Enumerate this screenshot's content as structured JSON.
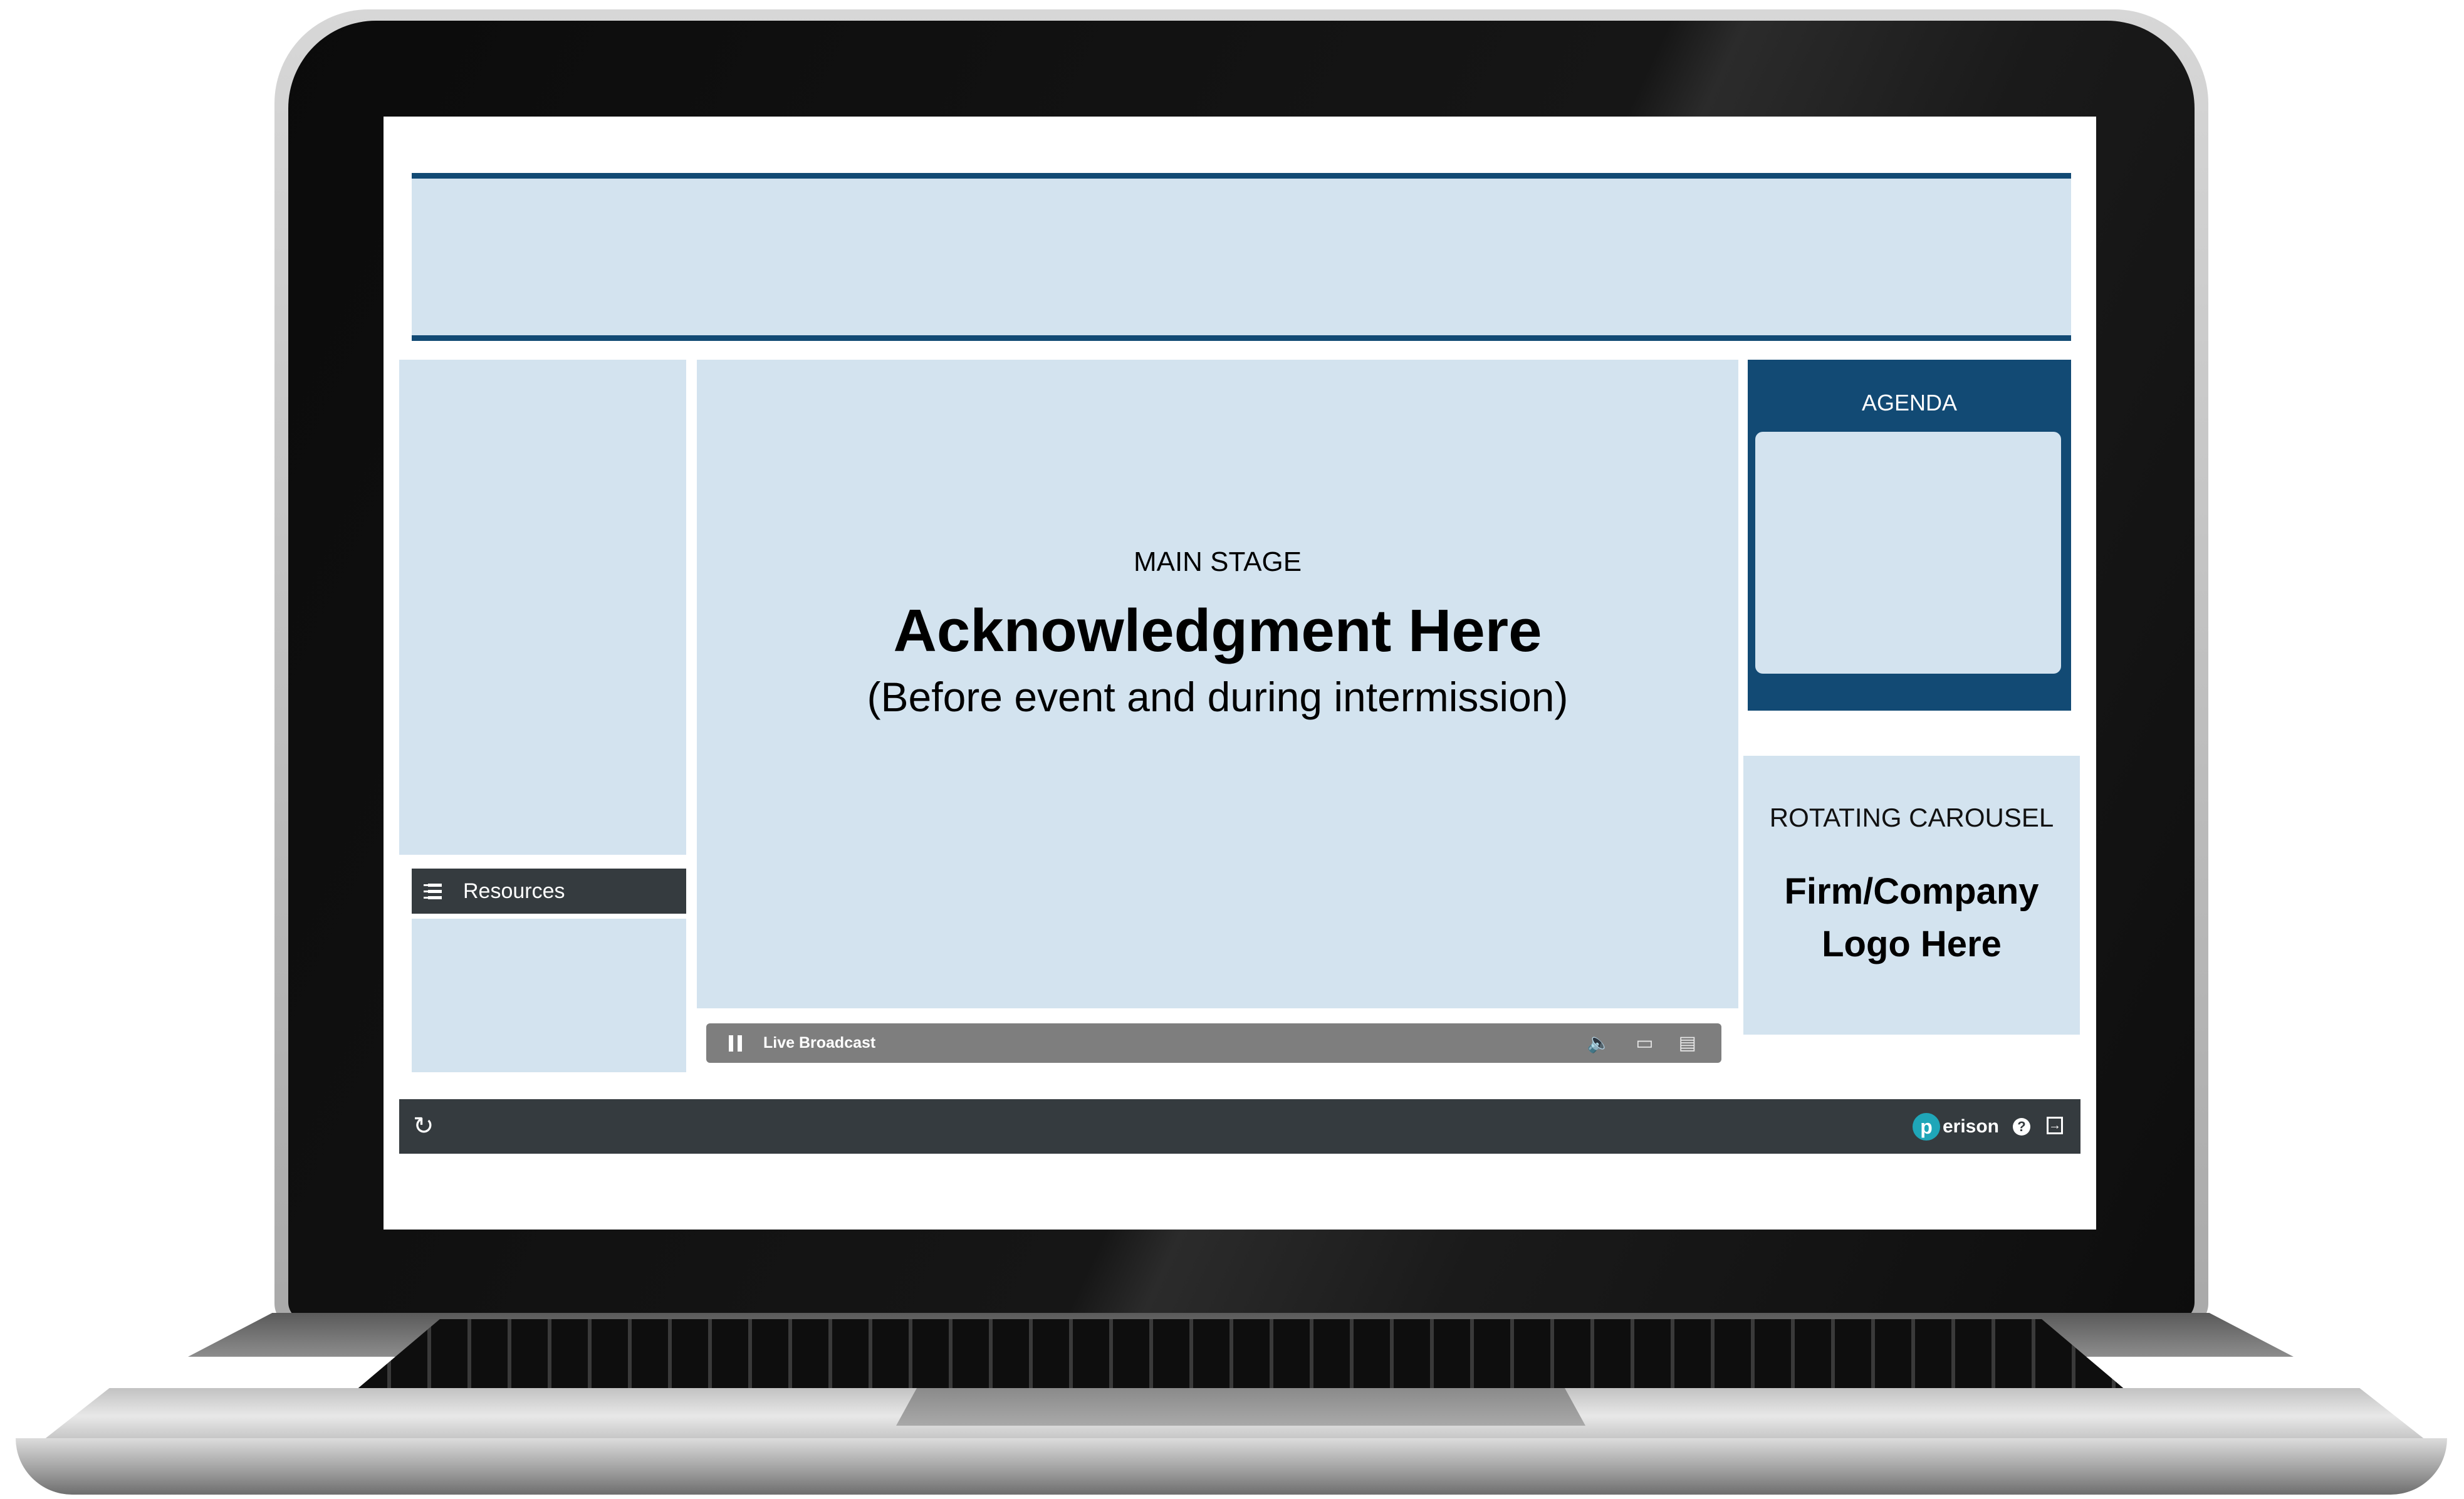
{
  "main_stage": {
    "label": "MAIN STAGE",
    "title": "Acknowledgment  Here",
    "subtitle": "(Before event and during intermission)"
  },
  "agenda": {
    "label": "AGENDA"
  },
  "carousel": {
    "label": "ROTATING CAROUSEL",
    "line1": "Firm/Company",
    "line2": "Logo Here"
  },
  "resources": {
    "label": "Resources"
  },
  "player": {
    "status_label": "Live Broadcast"
  },
  "footer": {
    "brand_letter": "p",
    "brand_text": "erison"
  },
  "icons": [
    "list-icon",
    "pause-icon",
    "volume-icon",
    "screen-icon",
    "captions-icon",
    "refresh-icon",
    "help-icon",
    "logout-icon"
  ],
  "colors": {
    "banner_border": "#124a74",
    "panel_fill": "#d3e3ef",
    "dark_bar": "#353b3f",
    "player_bar": "#7e7e7e",
    "brand": "#1fa6b8"
  }
}
